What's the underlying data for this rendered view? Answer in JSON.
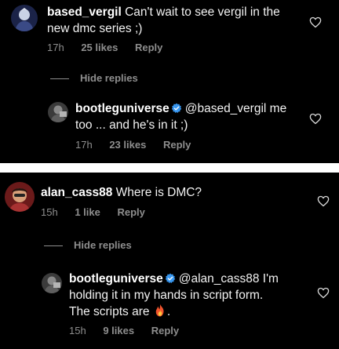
{
  "thread1": {
    "comment": {
      "username": "based_vergil",
      "text_line1": "Can't wait to see vergil in the",
      "text_line2": "new dmc series ;)",
      "time": "17h",
      "likes": "25 likes",
      "reply_label": "Reply"
    },
    "hide_replies_label": "Hide replies",
    "reply": {
      "username": "bootleguniverse",
      "mention": "@based_vergil me",
      "text_line2": "too ... and he's in it ;)",
      "time": "17h",
      "likes": "23 likes",
      "reply_label": "Reply"
    }
  },
  "thread2": {
    "comment": {
      "username": "alan_cass88",
      "text": "Where is DMC?",
      "time": "15h",
      "likes": "1 like",
      "reply_label": "Reply"
    },
    "hide_replies_label": "Hide replies",
    "reply": {
      "username": "bootleguniverse",
      "mention": "@alan_cass88 I'm",
      "text_line2": "holding it in my hands in script form.",
      "text_line3": "The scripts are",
      "text_line3_end": ".",
      "time": "15h",
      "likes": "9 likes",
      "reply_label": "Reply"
    }
  },
  "icons": {
    "like": "heart-outline-icon",
    "verified": "verified-badge-icon",
    "emoji": "fire-emoji"
  },
  "colors": {
    "background": "#000000",
    "primary_text": "#ffffff",
    "secondary_text": "#8e8e8e",
    "verified_blue": "#3897f0",
    "separator": "#ffffff"
  }
}
